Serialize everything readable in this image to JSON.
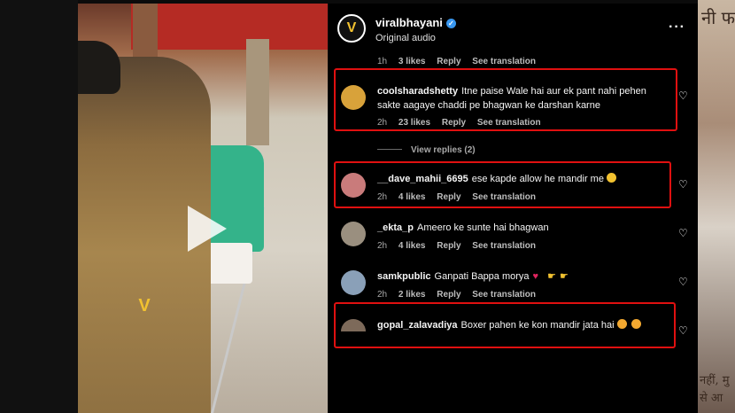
{
  "post": {
    "username": "viralbhayani",
    "subtitle": "Original audio",
    "avatar_glyph": "V"
  },
  "top_comment_meta": {
    "time": "1h",
    "likes": "3 likes",
    "reply": "Reply",
    "translation": "See translation"
  },
  "comments": [
    {
      "username": "coolsharadshetty",
      "text": "Itne paise Wale hai aur ek pant nahi pehen sakte aagaye chaddi pe bhagwan ke darshan karne",
      "time": "2h",
      "likes": "23 likes",
      "reply": "Reply",
      "translation": "See translation",
      "avatar_color": "#d8a23a"
    },
    {
      "username": "__dave_mahii_6695",
      "text": "ese kapde allow he mandir me",
      "time": "2h",
      "likes": "4 likes",
      "reply": "Reply",
      "translation": "See translation",
      "avatar_color": "#c97b7b"
    },
    {
      "username": "_ekta_p",
      "text": "Ameero ke sunte hai bhagwan",
      "time": "2h",
      "likes": "4 likes",
      "reply": "Reply",
      "translation": "See translation",
      "avatar_color": "#9a8f7f"
    },
    {
      "username": "samkpublic",
      "text": "Ganpati Bappa morya",
      "time": "2h",
      "likes": "2 likes",
      "reply": "Reply",
      "translation": "See translation",
      "avatar_color": "#8aa0b8"
    },
    {
      "username": "gopal_zalavadiya",
      "text": "Boxer pahen ke kon mandir jata hai",
      "avatar_color": "#7d6a5a"
    }
  ],
  "view_replies": "View replies (2)",
  "background_text": {
    "top": "नी फ",
    "bottom": "नहीं, मु\nसे आ"
  },
  "colors": {
    "highlight": "#e01010",
    "verified": "#3897f0",
    "brand_yellow": "#f2c230"
  }
}
